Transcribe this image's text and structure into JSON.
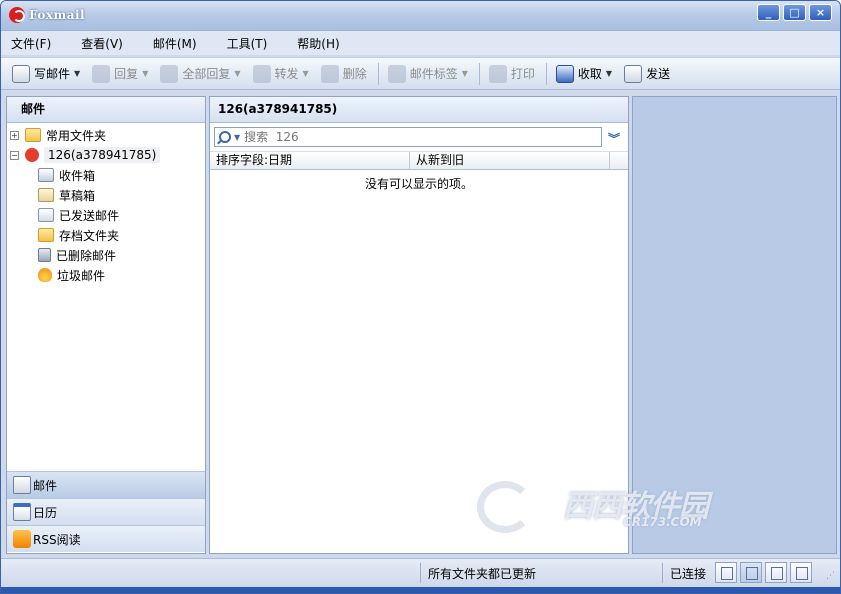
{
  "window": {
    "title": "Foxmail",
    "controls": [
      "_",
      "□",
      "×"
    ]
  },
  "menu": [
    "文件(F)",
    "查看(V)",
    "邮件(M)",
    "工具(T)",
    "帮助(H)"
  ],
  "toolbar": {
    "write": "写邮件",
    "reply": "回复",
    "reply_all": "全部回复",
    "forward": "转发",
    "delete": "删除",
    "tag": "邮件标签",
    "print": "打印",
    "receive": "收取",
    "send": "发送"
  },
  "left": {
    "header": "邮件",
    "common_folder": "常用文件夹",
    "account": "126(a378941785)",
    "folders": [
      "收件箱",
      "草稿箱",
      "已发送邮件",
      "存档文件夹",
      "已删除邮件",
      "垃圾邮件"
    ]
  },
  "nav": {
    "mail": "邮件",
    "calendar": "日历",
    "rss": "RSS阅读"
  },
  "middle": {
    "header": "126(a378941785)",
    "search_placeholder": "搜索  126",
    "sort_label": "排序字段:日期",
    "order_label": "从新到旧",
    "empty": "没有可以显示的项。"
  },
  "status": {
    "message": "所有文件夹都已更新",
    "connection": "已连接"
  },
  "watermark": {
    "main": "西西软件园",
    "sub": "CR173.COM"
  },
  "colors": {
    "accent": "#3b62a8",
    "panel_bg": "#b8cae6",
    "chrome": "#cfd9e9"
  }
}
